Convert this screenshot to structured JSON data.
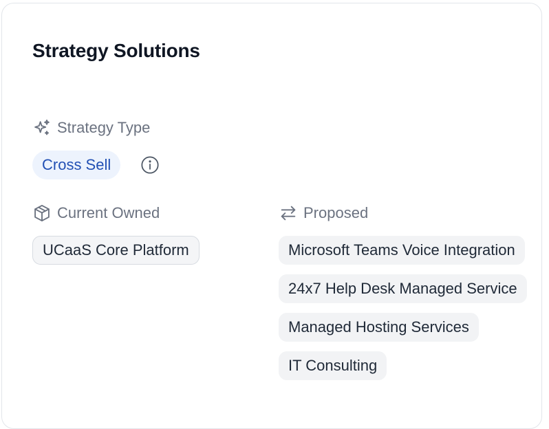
{
  "card": {
    "title": "Strategy Solutions"
  },
  "strategy_type": {
    "label": "Strategy Type",
    "icon": "sparkles-icon",
    "value": "Cross Sell",
    "info_icon": "info-icon"
  },
  "current_owned": {
    "label": "Current Owned",
    "icon": "box-icon",
    "items": [
      "UCaaS Core Platform"
    ]
  },
  "proposed": {
    "label": "Proposed",
    "icon": "swap-arrows-icon",
    "items": [
      "Microsoft Teams Voice Integration",
      "24x7 Help Desk Managed Service",
      "Managed Hosting Services",
      "IT Consulting"
    ]
  },
  "colors": {
    "accent": "#2250b4",
    "accent_bg": "#edf3fd",
    "muted_text": "#6b7280",
    "chip_bg": "#f2f3f5"
  }
}
